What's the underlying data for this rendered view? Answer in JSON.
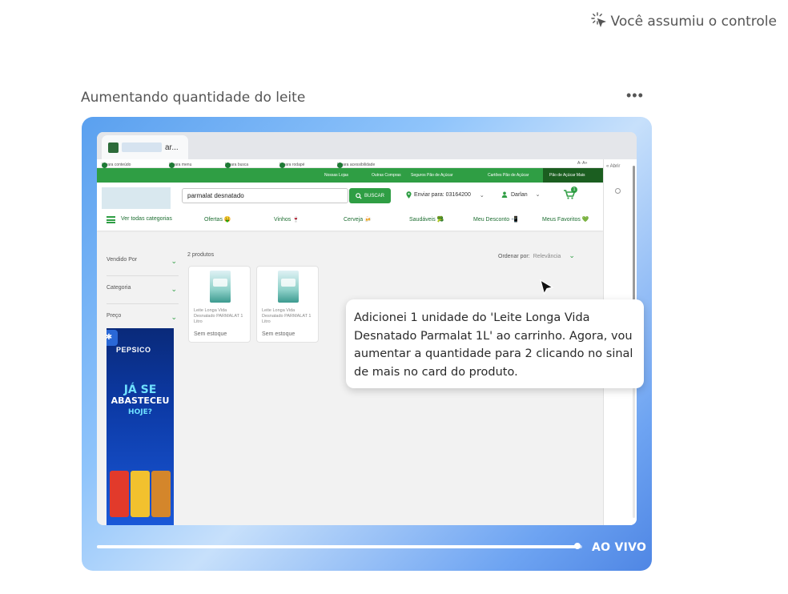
{
  "status": {
    "label": "Você assumiu o controle",
    "icon": "takeover-sparkle-icon"
  },
  "task": {
    "title": "Aumentando quantidade do leite",
    "menu": "•••"
  },
  "browser": {
    "tab_title": "ar..."
  },
  "site": {
    "accessibility": [
      {
        "label": "Ir para conteúdo",
        "key": "1"
      },
      {
        "label": "Ir para menu",
        "key": "2"
      },
      {
        "label": "Ir para busca",
        "key": "3"
      },
      {
        "label": "Ir para rodapé",
        "key": "4"
      },
      {
        "label": "Ir para acessibilidade",
        "key": "5"
      }
    ],
    "accessibility_right": "A- A+",
    "topnav": [
      "Nossas Lojas",
      "Outras Compras",
      "Seguros Pão de Açúcar",
      "Cartões Pão de Açúcar",
      "Pão de Açúcar Mais"
    ],
    "search_value": "parmalat desnatado",
    "search_button": "BUSCAR",
    "deliver": "Enviar para: 03164200",
    "user": "Darlan",
    "cart_count": "1",
    "categories": [
      "Ver todas categorias",
      "Ofertas 🤑",
      "Vinhos 🍷",
      "Cerveja 🍻",
      "Saudáveis 🥦",
      "Meu Desconto 📲",
      "Meus Favoritos 💚"
    ],
    "filters": [
      "Vendido Por",
      "Categoria",
      "Preço"
    ],
    "product_count": "2 produtos",
    "order_label": "Ordenar por:",
    "order_value": "Relevância",
    "products": [
      {
        "name": "Leite Longa Vida Desnatado PARMALAT 1 Litro",
        "stock": "Sem estoque"
      },
      {
        "name": "Leite Longa Vida Desnatado PARMALAT 1 Litro",
        "stock": "Sem estoque"
      }
    ],
    "ad": {
      "brand": "PEPSICO",
      "line1": "JÁ SE",
      "line2": "ABASTECEU",
      "line3": "HOJE?"
    },
    "side_panel": "« Abrir"
  },
  "bubble": "Adicionei 1 unidade do 'Leite Longa Vida Desnatado Parmalat 1L' ao carrinho. Agora, vou aumentar a quantidade para 2 clicando no sinal de mais no card do produto.",
  "live": {
    "label": "AO VIVO",
    "progress": 0.99
  }
}
